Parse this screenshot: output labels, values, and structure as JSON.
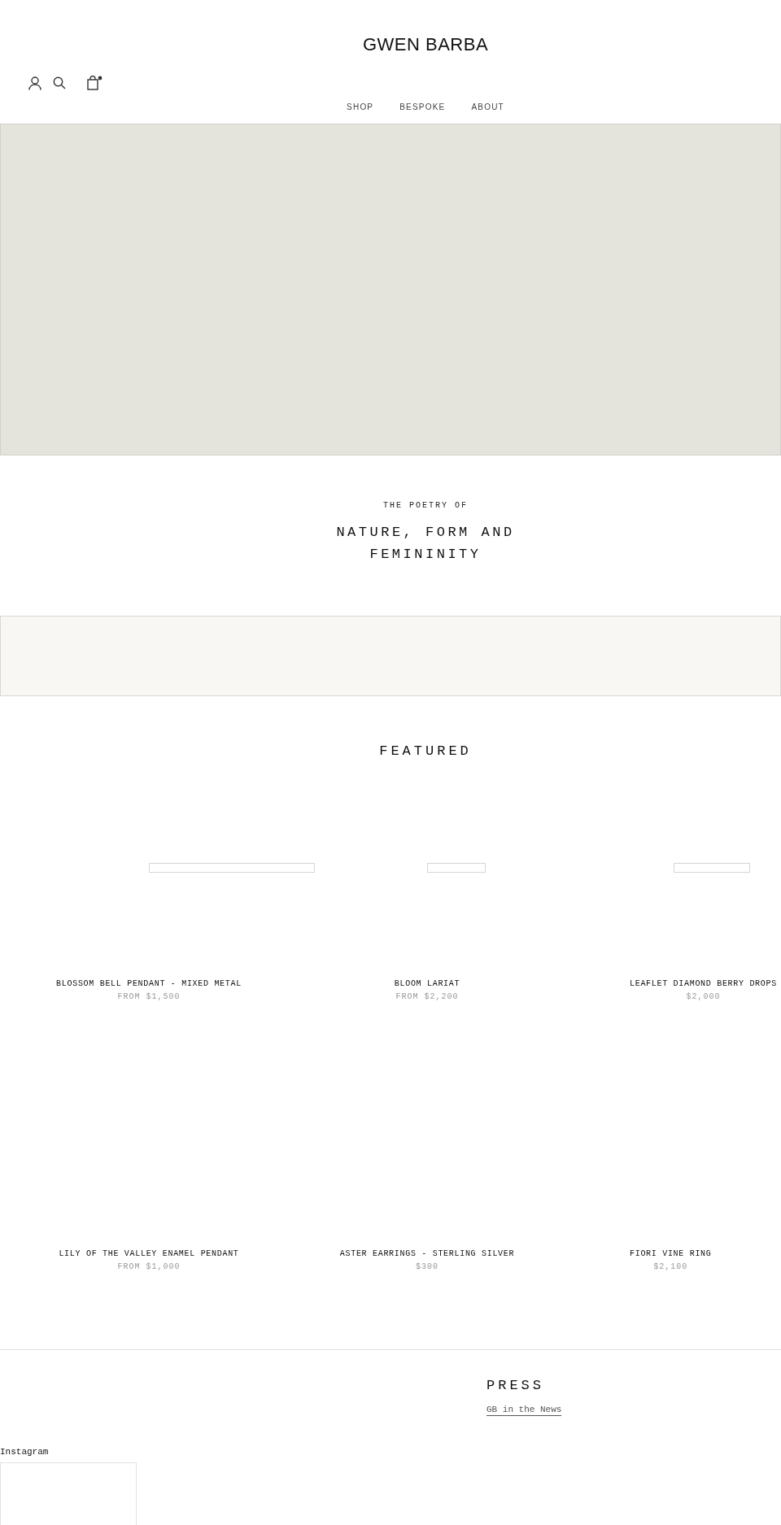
{
  "header": {
    "logo": "GWEN BARBA",
    "cart": {
      "has_items": true
    },
    "nav": [
      {
        "label": "SHOP"
      },
      {
        "label": "BESPOKE"
      },
      {
        "label": "ABOUT"
      }
    ]
  },
  "intro": {
    "eyebrow": "THE POETRY OF",
    "heading_lines": [
      "NATURE, FORM AND",
      "FEMININITY"
    ]
  },
  "featured": {
    "title": "FEATURED",
    "products": [
      {
        "name": "BLOSSOM BELL PENDANT - MIXED METAL",
        "price": "FROM $1,500",
        "kind": "placeholder_wide"
      },
      {
        "name": "BLOOM LARIAT",
        "price": "FROM $2,200",
        "kind": "placeholder_narrow"
      },
      {
        "name": "LEAFLET DIAMOND BERRY DROPS",
        "price": "$2,000",
        "kind": "placeholder_wide"
      },
      {
        "name": "LILY OF THE VALLEY ENAMEL PENDANT",
        "price": "FROM $1,000",
        "kind": "plain"
      },
      {
        "name": "ASTER EARRINGS - STERLING SILVER",
        "price": "$300",
        "kind": "plain"
      },
      {
        "name": "FIORI VINE RING",
        "price": "$2,100",
        "kind": "plain"
      }
    ]
  },
  "press": {
    "title": "PRESS",
    "link": "GB in the News"
  },
  "instagram": {
    "label": "Instagram"
  }
}
